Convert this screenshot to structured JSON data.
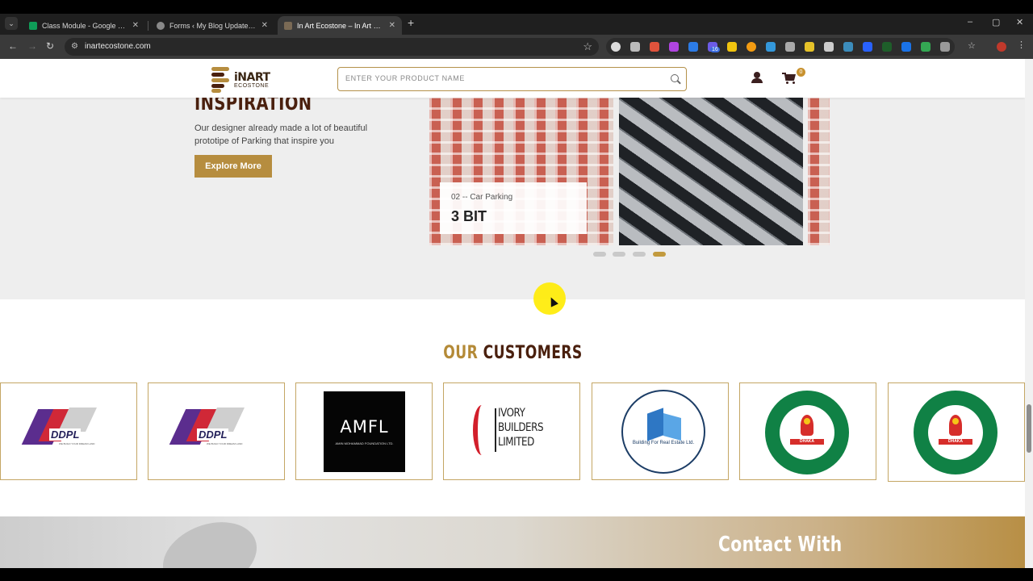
{
  "browser": {
    "tabs": [
      {
        "title": "Class Module - Google Sheets",
        "favicon_color": "#0f9d58",
        "active": false
      },
      {
        "title": "Forms ‹ My Blog Update 11 — ",
        "favicon_color": "#888888",
        "active": false
      },
      {
        "title": "In Art Ecostone – In Art Ecosto",
        "favicon_color": "#7a6a55",
        "active": true
      }
    ],
    "new_tab": "+",
    "window_controls": {
      "minimize": "–",
      "maximize": "▢",
      "close": "✕"
    },
    "url": "inartecostone.com",
    "extension_badge": "16"
  },
  "header": {
    "logo": {
      "name": "iNART",
      "sub": "ECOSTONE"
    },
    "search_placeholder": "ENTER YOUR PRODUCT NAME",
    "cart_count": "0"
  },
  "inspiration": {
    "title": "INSPIRATION",
    "description": "Our designer already made a lot of beautiful prototipe of Parking that inspire you",
    "button": "Explore More",
    "slide_caption": {
      "subtitle": "02 -- Car Parking",
      "title": "3 BIT"
    },
    "carousel": {
      "total": 4,
      "active_index": 3
    }
  },
  "customers": {
    "title_a": "OUR",
    "title_b": "CUSTOMERS",
    "items": [
      {
        "name": "DDPL",
        "tagline": "WE BUILD YOUR DREAM LAND"
      },
      {
        "name": "DDPL",
        "tagline": "WE BUILD YOUR DREAM LAND"
      },
      {
        "name": "AMFL",
        "tagline": "AMIN MOHAMMAD FOUNDATION LTD."
      },
      {
        "name": "IVORY\nBUILDERS\nLIMITED"
      },
      {
        "name": "Building For Real Estate Ltd."
      },
      {
        "name": "DHAKA"
      },
      {
        "name": "DHAKA"
      }
    ]
  },
  "contact": {
    "title": "Contact With"
  },
  "colors": {
    "brand_gold": "#b68d3f",
    "brand_brown": "#4a200e"
  }
}
